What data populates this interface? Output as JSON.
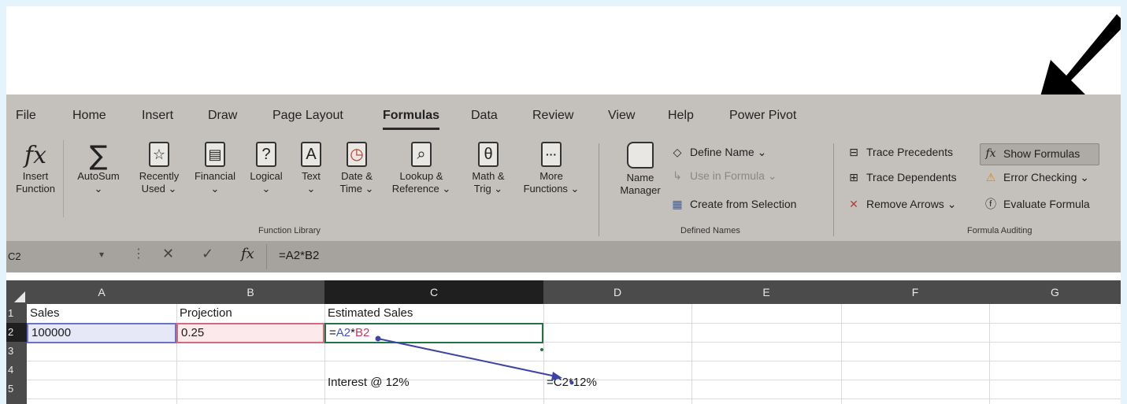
{
  "ribbon": {
    "tabs": [
      {
        "label": "File"
      },
      {
        "label": "Home"
      },
      {
        "label": "Insert"
      },
      {
        "label": "Draw"
      },
      {
        "label": "Page Layout"
      },
      {
        "label": "Formulas"
      },
      {
        "label": "Data"
      },
      {
        "label": "Review"
      },
      {
        "label": "View"
      },
      {
        "label": "Help"
      },
      {
        "label": "Power Pivot"
      }
    ],
    "active_tab": "Formulas",
    "insert_function": {
      "glyph": "fx",
      "line1": "Insert",
      "line2": "Function"
    },
    "function_library": {
      "label": "Function Library",
      "buttons": [
        {
          "icon": "sum-icon",
          "glyph": "∑",
          "line1": "AutoSum",
          "line2": "⌄"
        },
        {
          "icon": "star-book-icon",
          "glyph": "☆",
          "line1": "Recently",
          "line2": "Used ⌄"
        },
        {
          "icon": "financial-book-icon",
          "glyph": "▤",
          "line1": "Financial",
          "line2": "⌄"
        },
        {
          "icon": "logical-book-icon",
          "glyph": "?",
          "line1": "Logical",
          "line2": "⌄"
        },
        {
          "icon": "text-book-icon",
          "glyph": "A",
          "line1": "Text",
          "line2": "⌄"
        },
        {
          "icon": "clock-book-icon",
          "glyph": "◷",
          "line1": "Date &",
          "line2": "Time ⌄"
        },
        {
          "icon": "lookup-book-icon",
          "glyph": "⌕",
          "line1": "Lookup &",
          "line2": "Reference ⌄"
        },
        {
          "icon": "theta-book-icon",
          "glyph": "θ",
          "line1": "Math &",
          "line2": "Trig ⌄"
        },
        {
          "icon": "more-book-icon",
          "glyph": "···",
          "line1": "More",
          "line2": "Functions ⌄"
        }
      ]
    },
    "defined_names": {
      "label": "Defined Names",
      "name_manager": {
        "line1": "Name",
        "line2": "Manager"
      },
      "define_name": "Define Name ⌄",
      "use_in_formula": "Use in Formula ⌄",
      "create_from_selection": "Create from Selection"
    },
    "formula_auditing": {
      "label": "Formula Auditing",
      "trace_precedents": "Trace Precedents",
      "trace_dependents": "Trace Dependents",
      "remove_arrows": "Remove Arrows ⌄",
      "show_formulas": "Show Formulas",
      "error_checking": "Error Checking ⌄",
      "evaluate_formula": "Evaluate Formula"
    }
  },
  "formula_bar": {
    "name_box": "C2",
    "name_box_arrow": "▾",
    "cancel": "✕",
    "enter": "✓",
    "fx": "fx",
    "formula": "=A2*B2"
  },
  "grid": {
    "columns": [
      "A",
      "B",
      "C",
      "D",
      "E",
      "F",
      "G"
    ],
    "rows": [
      "1",
      "2",
      "3",
      "4",
      "5"
    ],
    "cells": {
      "A1": "Sales",
      "B1": "Projection",
      "C1": "Estimated Sales",
      "A2": "100000",
      "B2": "0.25",
      "C2_part1": "=",
      "C2_ref_a": "A2",
      "C2_op": "*",
      "C2_ref_b": "B2",
      "C4": "Interest @ 12%",
      "D4": "=C2*12%"
    }
  },
  "colors": {
    "ribbon_bg": "#c4c1bc",
    "selection_green": "#217346",
    "ref_a_blue": "#3f55c9",
    "ref_b_red": "#c4395d",
    "tracer_arrow": "#3e44a6"
  }
}
